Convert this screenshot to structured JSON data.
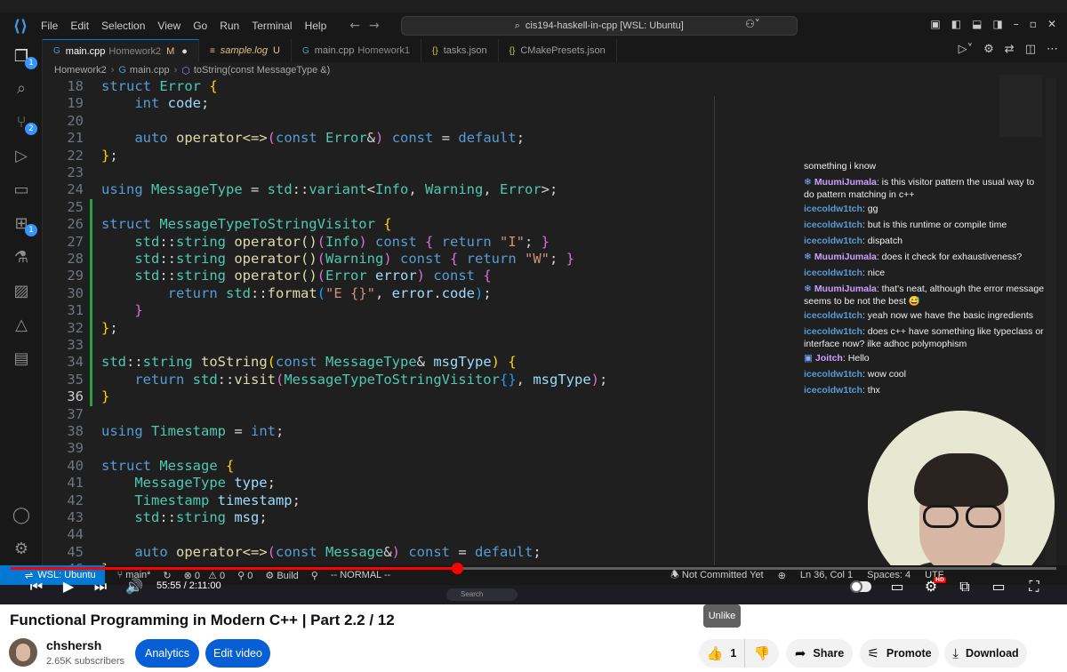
{
  "vscode": {
    "menu": [
      "File",
      "Edit",
      "Selection",
      "View",
      "Go",
      "Run",
      "Terminal",
      "Help"
    ],
    "command_center": "cis194-haskell-in-cpp [WSL: Ubuntu]",
    "tabs": [
      {
        "label": "main.cpp",
        "sub": "Homework2",
        "modified": "M",
        "dirty": "●",
        "icon": "cpp-icon"
      },
      {
        "label": "sample.log",
        "modified": "U",
        "icon": "log-icon"
      },
      {
        "label": "main.cpp",
        "sub": "Homework1",
        "icon": "cpp-icon"
      },
      {
        "label": "tasks.json",
        "icon": "json-icon"
      },
      {
        "label": "CMakePresets.json",
        "icon": "json-icon"
      }
    ],
    "breadcrumb": [
      "Homework2",
      "main.cpp",
      "toString(const MessageType &)"
    ],
    "activity_badges": {
      "explorer": "1",
      "source_control": "2",
      "extensions": "1"
    },
    "status": {
      "remote": "WSL: Ubuntu",
      "branch": "main*",
      "errors": "0",
      "warnings": "0",
      "ports": "0",
      "build": "Build",
      "vim_mode": "-- NORMAL --",
      "blame": "Not Committed Yet",
      "position": "Ln 36, Col 1",
      "spaces": "Spaces: 4",
      "encoding": "UTF"
    },
    "taskbar_search": "Search"
  },
  "code": {
    "current_line": "36",
    "lines": [
      {
        "n": "18",
        "parts": [
          [
            "kw",
            "struct "
          ],
          [
            "ty",
            "Error "
          ],
          [
            "br1",
            "{"
          ]
        ]
      },
      {
        "n": "19",
        "parts": [
          [
            "pl",
            "    "
          ],
          [
            "kw",
            "int "
          ],
          [
            "va",
            "code"
          ],
          [
            "pl",
            ";"
          ]
        ]
      },
      {
        "n": "20",
        "parts": []
      },
      {
        "n": "21",
        "parts": [
          [
            "pl",
            "    "
          ],
          [
            "kw",
            "auto "
          ],
          [
            "fn",
            "operator<=>"
          ],
          [
            "br2",
            "("
          ],
          [
            "kw",
            "const "
          ],
          [
            "ty",
            "Error"
          ],
          [
            "pl",
            "&"
          ],
          [
            "br2",
            ")"
          ],
          [
            "kw",
            " const "
          ],
          [
            "pl",
            "= "
          ],
          [
            "kw",
            "default"
          ],
          [
            "pl",
            ";"
          ]
        ]
      },
      {
        "n": "22",
        "parts": [
          [
            "br1",
            "}"
          ],
          [
            "pl",
            ";"
          ]
        ]
      },
      {
        "n": "23",
        "parts": []
      },
      {
        "n": "24",
        "parts": [
          [
            "kw",
            "using "
          ],
          [
            "ty",
            "MessageType "
          ],
          [
            "pl",
            "= "
          ],
          [
            "ty",
            "std"
          ],
          [
            "pl",
            "::"
          ],
          [
            "ty",
            "variant"
          ],
          [
            "pl",
            "<"
          ],
          [
            "ty",
            "Info"
          ],
          [
            "pl",
            ", "
          ],
          [
            "ty",
            "Warning"
          ],
          [
            "pl",
            ", "
          ],
          [
            "ty",
            "Error"
          ],
          [
            "pl",
            ">;"
          ]
        ]
      },
      {
        "n": "25",
        "parts": []
      },
      {
        "n": "26",
        "parts": [
          [
            "kw",
            "struct "
          ],
          [
            "ty",
            "MessageTypeToStringVisitor "
          ],
          [
            "br1",
            "{"
          ]
        ]
      },
      {
        "n": "27",
        "parts": [
          [
            "pl",
            "    "
          ],
          [
            "ty",
            "std"
          ],
          [
            "pl",
            "::"
          ],
          [
            "ty",
            "string "
          ],
          [
            "fn",
            "operator()"
          ],
          [
            "br2",
            "("
          ],
          [
            "ty",
            "Info"
          ],
          [
            "br2",
            ")"
          ],
          [
            "kw",
            " const "
          ],
          [
            "br2",
            "{"
          ],
          [
            "kw",
            " return "
          ],
          [
            "st",
            "\"I\""
          ],
          [
            "pl",
            "; "
          ],
          [
            "br2",
            "}"
          ]
        ]
      },
      {
        "n": "28",
        "parts": [
          [
            "pl",
            "    "
          ],
          [
            "ty",
            "std"
          ],
          [
            "pl",
            "::"
          ],
          [
            "ty",
            "string "
          ],
          [
            "fn",
            "operator()"
          ],
          [
            "br2",
            "("
          ],
          [
            "ty",
            "Warning"
          ],
          [
            "br2",
            ")"
          ],
          [
            "kw",
            " const "
          ],
          [
            "br2",
            "{"
          ],
          [
            "kw",
            " return "
          ],
          [
            "st",
            "\"W\""
          ],
          [
            "pl",
            "; "
          ],
          [
            "br2",
            "}"
          ]
        ]
      },
      {
        "n": "29",
        "parts": [
          [
            "pl",
            "    "
          ],
          [
            "ty",
            "std"
          ],
          [
            "pl",
            "::"
          ],
          [
            "ty",
            "string "
          ],
          [
            "fn",
            "operator()"
          ],
          [
            "br2",
            "("
          ],
          [
            "ty",
            "Error "
          ],
          [
            "va",
            "error"
          ],
          [
            "br2",
            ")"
          ],
          [
            "kw",
            " const "
          ],
          [
            "br2",
            "{"
          ]
        ]
      },
      {
        "n": "30",
        "parts": [
          [
            "pl",
            "        "
          ],
          [
            "kw",
            "return "
          ],
          [
            "ty",
            "std"
          ],
          [
            "pl",
            "::"
          ],
          [
            "fn",
            "format"
          ],
          [
            "br3",
            "("
          ],
          [
            "st",
            "\"E {}\""
          ],
          [
            "pl",
            ", "
          ],
          [
            "va",
            "error"
          ],
          [
            "pl",
            "."
          ],
          [
            "va",
            "code"
          ],
          [
            "br3",
            ")"
          ],
          [
            "pl",
            ";"
          ]
        ]
      },
      {
        "n": "31",
        "parts": [
          [
            "pl",
            "    "
          ],
          [
            "br2",
            "}"
          ]
        ]
      },
      {
        "n": "32",
        "parts": [
          [
            "br1",
            "}"
          ],
          [
            "pl",
            ";"
          ]
        ]
      },
      {
        "n": "33",
        "parts": []
      },
      {
        "n": "34",
        "parts": [
          [
            "ty",
            "std"
          ],
          [
            "pl",
            "::"
          ],
          [
            "ty",
            "string "
          ],
          [
            "fn",
            "toString"
          ],
          [
            "br1",
            "("
          ],
          [
            "kw",
            "const "
          ],
          [
            "ty",
            "MessageType"
          ],
          [
            "pl",
            "& "
          ],
          [
            "va",
            "msgType"
          ],
          [
            "br1",
            ")"
          ],
          [
            "pl",
            " "
          ],
          [
            "br1",
            "{"
          ]
        ]
      },
      {
        "n": "35",
        "parts": [
          [
            "pl",
            "    "
          ],
          [
            "kw",
            "return "
          ],
          [
            "ty",
            "std"
          ],
          [
            "pl",
            "::"
          ],
          [
            "fn",
            "visit"
          ],
          [
            "br2",
            "("
          ],
          [
            "ty",
            "MessageTypeToStringVisitor"
          ],
          [
            "br3",
            "{}"
          ],
          [
            "pl",
            ", "
          ],
          [
            "va",
            "msgType"
          ],
          [
            "br2",
            ")"
          ],
          [
            "pl",
            ";"
          ]
        ]
      },
      {
        "n": "36",
        "parts": [
          [
            "br1",
            "}"
          ]
        ]
      },
      {
        "n": "37",
        "parts": []
      },
      {
        "n": "38",
        "parts": [
          [
            "kw",
            "using "
          ],
          [
            "ty",
            "Timestamp "
          ],
          [
            "pl",
            "= "
          ],
          [
            "kw",
            "int"
          ],
          [
            "pl",
            ";"
          ]
        ]
      },
      {
        "n": "39",
        "parts": []
      },
      {
        "n": "40",
        "parts": [
          [
            "kw",
            "struct "
          ],
          [
            "ty",
            "Message "
          ],
          [
            "br1",
            "{"
          ]
        ]
      },
      {
        "n": "41",
        "parts": [
          [
            "pl",
            "    "
          ],
          [
            "ty",
            "MessageType "
          ],
          [
            "va",
            "type"
          ],
          [
            "pl",
            ";"
          ]
        ]
      },
      {
        "n": "42",
        "parts": [
          [
            "pl",
            "    "
          ],
          [
            "ty",
            "Timestamp "
          ],
          [
            "va",
            "timestamp"
          ],
          [
            "pl",
            ";"
          ]
        ]
      },
      {
        "n": "43",
        "parts": [
          [
            "pl",
            "    "
          ],
          [
            "ty",
            "std"
          ],
          [
            "pl",
            "::"
          ],
          [
            "ty",
            "string "
          ],
          [
            "va",
            "msg"
          ],
          [
            "pl",
            ";"
          ]
        ]
      },
      {
        "n": "44",
        "parts": []
      },
      {
        "n": "45",
        "parts": [
          [
            "pl",
            "    "
          ],
          [
            "kw",
            "auto "
          ],
          [
            "fn",
            "operator<=>"
          ],
          [
            "br2",
            "("
          ],
          [
            "kw",
            "const "
          ],
          [
            "ty",
            "Message"
          ],
          [
            "pl",
            "&"
          ],
          [
            "br2",
            ")"
          ],
          [
            "kw",
            " const "
          ],
          [
            "pl",
            "= "
          ],
          [
            "kw",
            "default"
          ],
          [
            "pl",
            ";"
          ]
        ]
      },
      {
        "n": "46",
        "parts": [
          [
            "br1",
            "}"
          ],
          [
            "pl",
            ";"
          ]
        ]
      }
    ]
  },
  "chat": [
    {
      "user": "",
      "text": "something i know",
      "badge": false
    },
    {
      "user": "MuumiJumala",
      "text": "is this visitor pattern the usual way to do pattern matching in c++",
      "badge": true
    },
    {
      "user": "icecoldw1tch",
      "text": "gg",
      "badge": false
    },
    {
      "user": "icecoldw1tch",
      "text": "but is this runtime or compile time",
      "badge": false
    },
    {
      "user": "icecoldw1tch",
      "text": "dispatch",
      "badge": false
    },
    {
      "user": "MuumiJumala",
      "text": "does it check for exhaustiveness?",
      "badge": true
    },
    {
      "user": "icecoldw1tch",
      "text": "nice",
      "badge": false
    },
    {
      "user": "MuumiJumala",
      "text": "that's neat, although the error message seems to be not the best 😅",
      "badge": true
    },
    {
      "user": "icecoldw1tch",
      "text": "yeah now we have the basic ingredients",
      "badge": false
    },
    {
      "user": "icecoldw1tch",
      "text": "does c++ have something like typeclass or interface now? ilke adhoc polymophism",
      "badge": false
    },
    {
      "user": "Joitch",
      "text": "Hello",
      "badge": true
    },
    {
      "user": "icecoldw1tch",
      "text": "wow cool",
      "badge": false
    },
    {
      "user": "icecoldw1tch",
      "text": "thx",
      "badge": false
    }
  ],
  "player": {
    "current_time": "55:55",
    "duration": "2:11:00",
    "time_display": "55:55 / 2:11:00",
    "progress_fraction": 0.427,
    "hd_badge": "HD",
    "icons": [
      "skip-previous-icon",
      "play-icon",
      "skip-next-icon",
      "volume-icon",
      "autoplay-toggle",
      "subtitles-icon",
      "settings-icon",
      "miniplayer-icon",
      "theater-icon",
      "fullscreen-icon"
    ]
  },
  "page": {
    "tooltip": "Unlike",
    "title": "Functional Programming in Modern C++ | Part 2.2 / 12",
    "channel": "chshersh",
    "subscribers": "2.65K subscribers",
    "analytics_label": "Analytics",
    "edit_label": "Edit video",
    "likes": "1",
    "share_label": "Share",
    "promote_label": "Promote",
    "download_label": "Download"
  },
  "colors": {
    "youtube_red": "#ff0000",
    "youtube_blue": "#065fd4",
    "vscode_accent": "#0078d4",
    "editor_bg": "#1f1f1f"
  }
}
